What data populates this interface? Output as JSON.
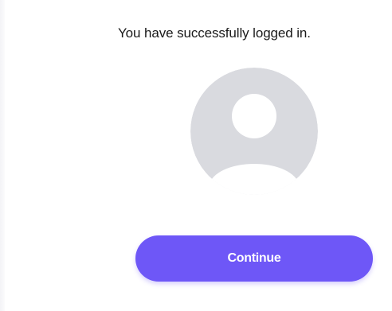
{
  "login": {
    "message": "You have successfully logged in.",
    "continue_label": "Continue"
  },
  "avatar": {
    "icon": "user-avatar-icon"
  },
  "colors": {
    "accent": "#6e57f7",
    "avatar_bg": "#d9dadf",
    "avatar_fg": "#ffffff"
  }
}
